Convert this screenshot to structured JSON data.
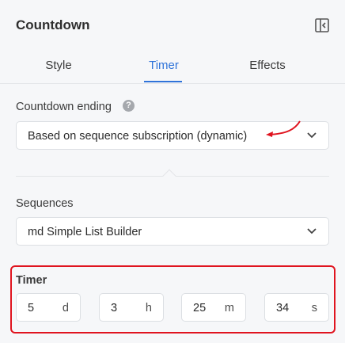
{
  "header": {
    "title": "Countdown",
    "collapse_icon": "panel-collapse-icon"
  },
  "tabs": [
    {
      "label": "Style",
      "active": false
    },
    {
      "label": "Timer",
      "active": true
    },
    {
      "label": "Effects",
      "active": false
    }
  ],
  "accent_color": "#2f73d9",
  "highlight_color": "#e0141f",
  "countdown_ending": {
    "label": "Countdown ending",
    "help_icon": "?",
    "selected": "Based on sequence subscription (dynamic)"
  },
  "sequences": {
    "label": "Sequences",
    "selected": "md Simple List Builder"
  },
  "timer": {
    "label": "Timer",
    "fields": [
      {
        "value": "5",
        "unit": "d"
      },
      {
        "value": "3",
        "unit": "h"
      },
      {
        "value": "25",
        "unit": "m"
      },
      {
        "value": "34",
        "unit": "s"
      }
    ]
  }
}
